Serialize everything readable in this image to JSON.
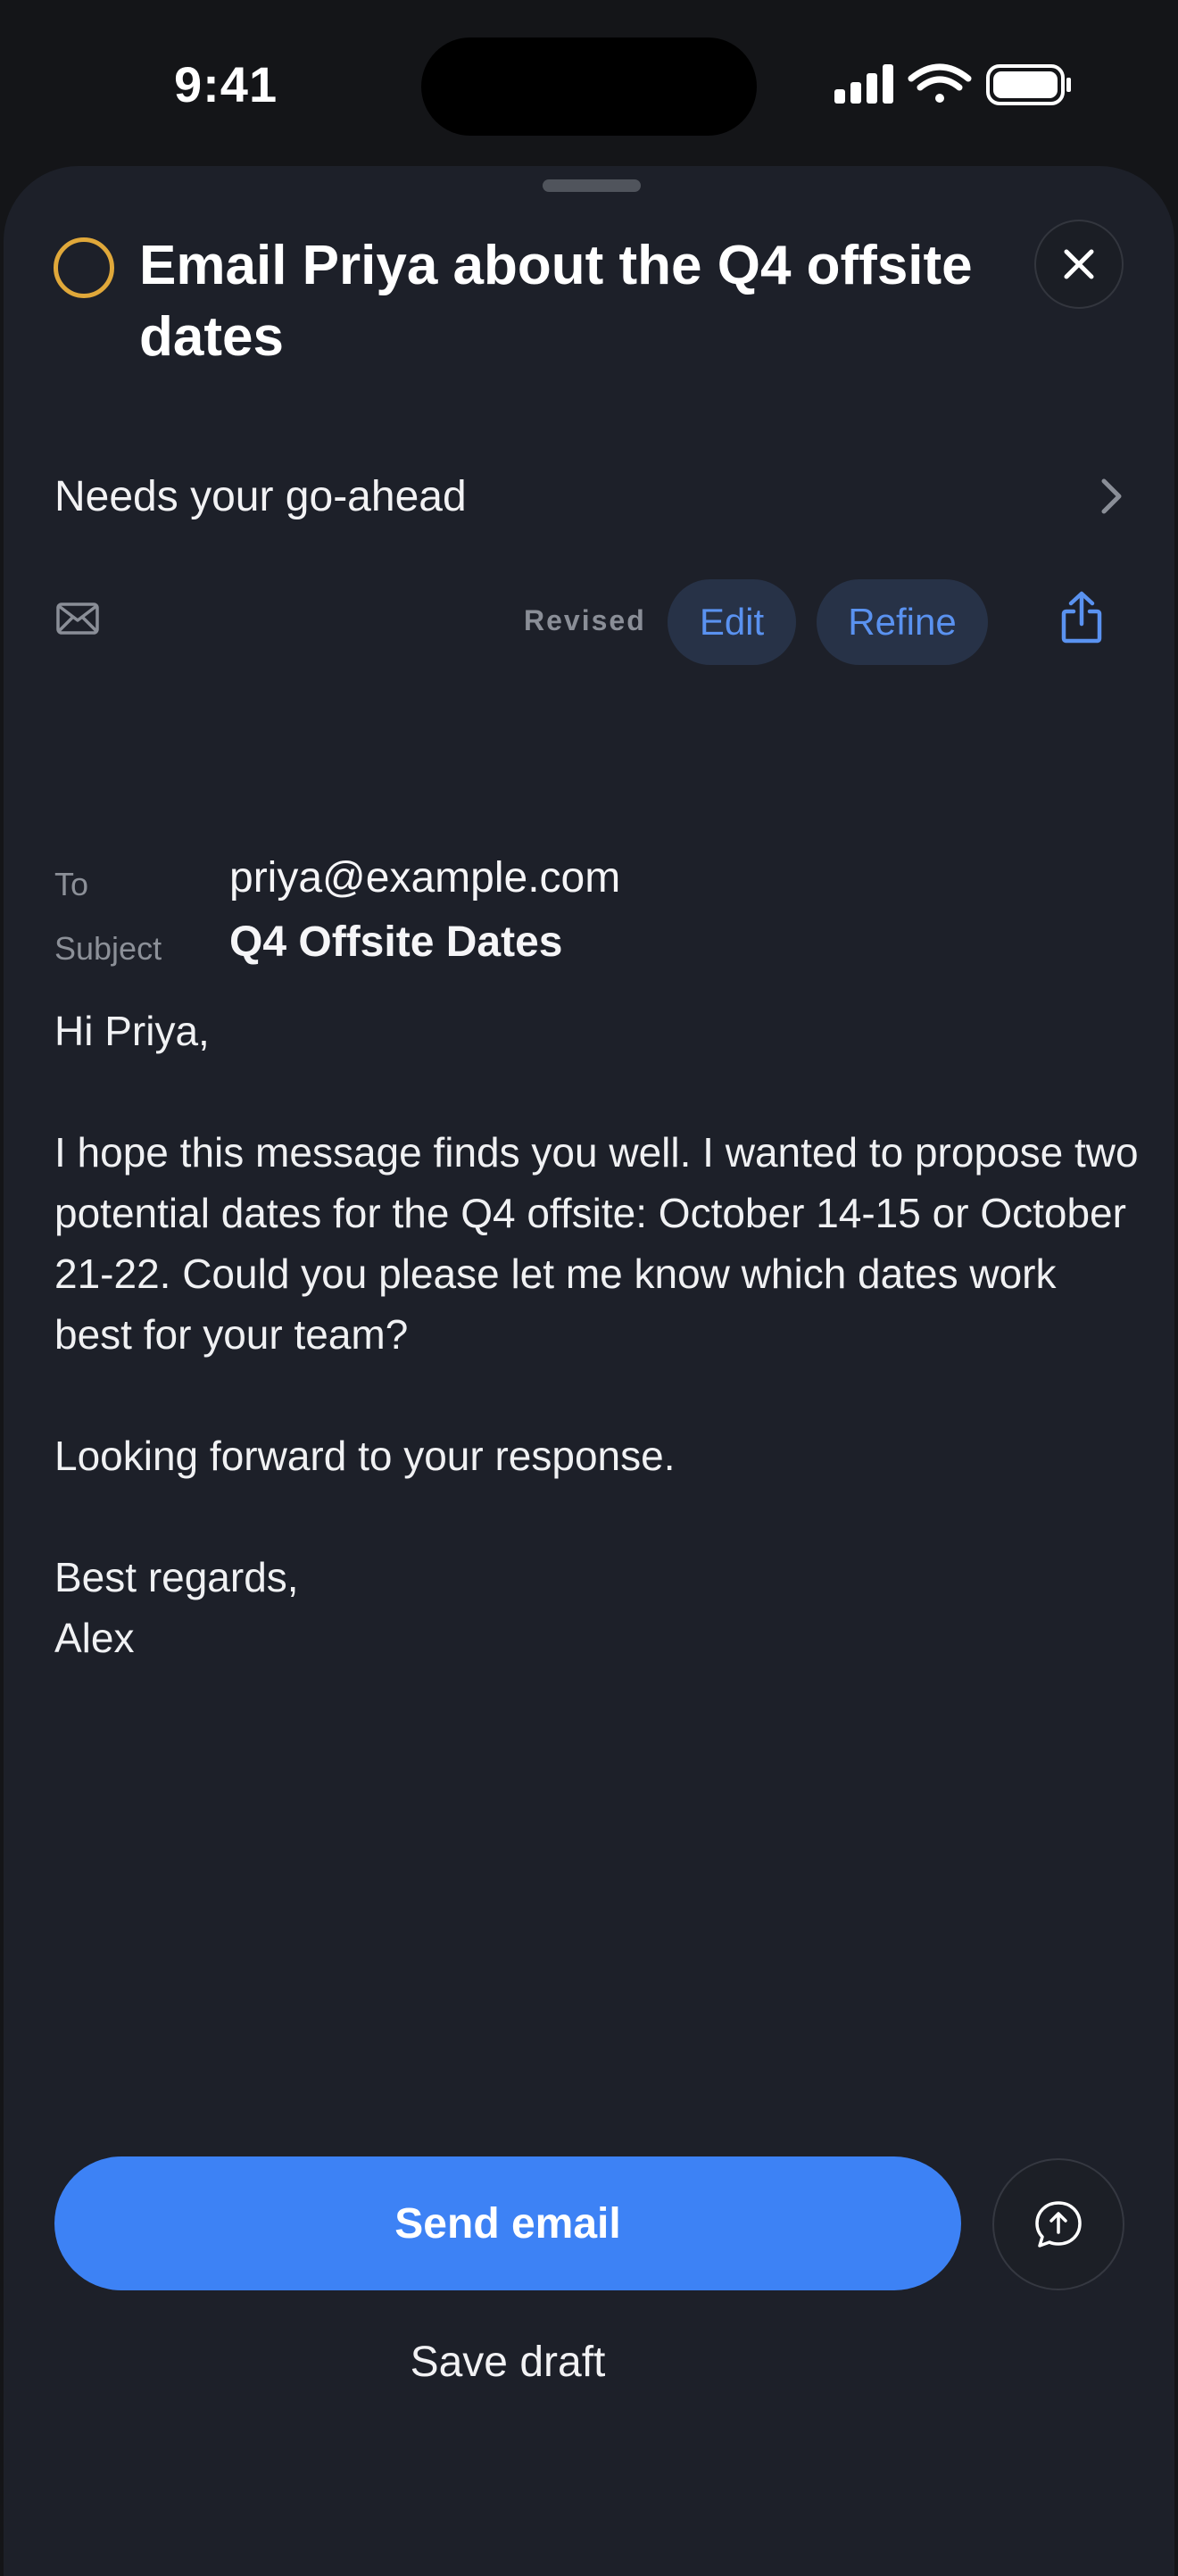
{
  "status_bar": {
    "time": "9:41",
    "icons": [
      "cellular-signal-icon",
      "wifi-icon",
      "battery-icon"
    ]
  },
  "task": {
    "title": "Email Priya about the Q4 offsite dates",
    "status_ring_color": "#e0a83a",
    "approval_label": "Needs your go-ahead"
  },
  "toolbar": {
    "revised_label": "Revised",
    "edit_label": "Edit",
    "refine_label": "Refine"
  },
  "email": {
    "to_label": "To",
    "to_value": "priya@example.com",
    "subject_label": "Subject",
    "subject_value": "Q4 Offsite Dates",
    "greeting": "Hi Priya,",
    "paragraph": "I hope this message finds you well. I wanted to propose two potential dates for the Q4 offsite: October 14-15 or October 21-22. Could you please let me know which dates work best for your team?",
    "closing": "Looking forward to your response.",
    "signoff": "Best regards,",
    "signature": "Alex"
  },
  "actions": {
    "send_label": "Send email",
    "save_draft_label": "Save draft",
    "accent_color": "#3d82f5"
  }
}
